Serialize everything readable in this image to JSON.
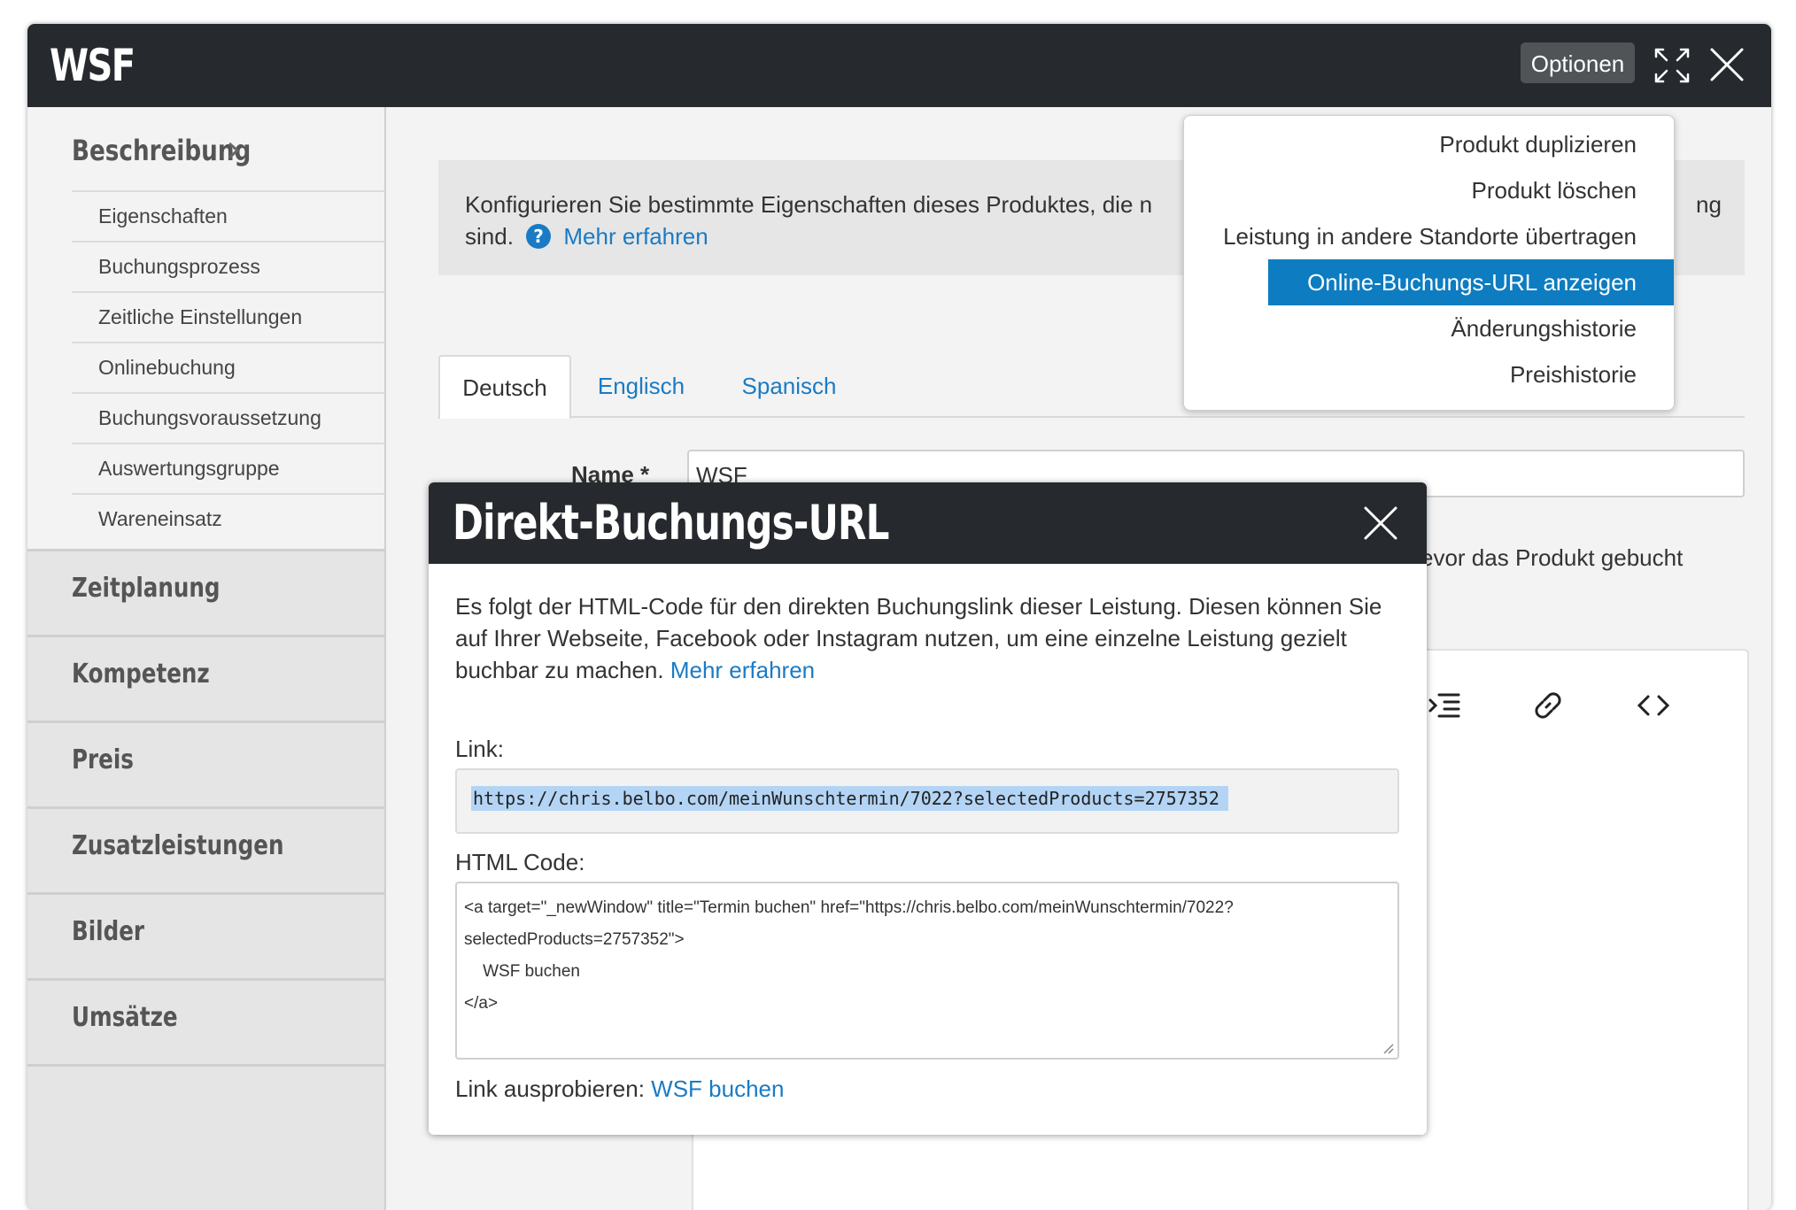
{
  "app": {
    "title": "WSF"
  },
  "topbar": {
    "options_label": "Optionen"
  },
  "sidebar": {
    "section_title": "Beschreibung",
    "sub_items": [
      "Eigenschaften",
      "Buchungsprozess",
      "Zeitliche Einstellungen",
      "Onlinebuchung",
      "Buchungsvoraussetzung",
      "Auswertungsgruppe",
      "Wareneinsatz"
    ],
    "groups": [
      "Zeitplanung",
      "Kompetenz",
      "Preis",
      "Zusatzleistungen",
      "Bilder",
      "Umsätze"
    ]
  },
  "info": {
    "text_line1": "Konfigurieren Sie bestimmte Eigenschaften dieses Produktes, die n",
    "text_line2": "sind.",
    "link": "Mehr erfahren",
    "tail": "ng"
  },
  "tabs": [
    {
      "label": "Deutsch",
      "active": true
    },
    {
      "label": "Englisch",
      "active": false
    },
    {
      "label": "Spanisch",
      "active": false
    }
  ],
  "form": {
    "name_label": "Name *",
    "name_value": "WSF",
    "partial_text": "evor das Produkt gebucht"
  },
  "dropdown": {
    "items": [
      "Produkt duplizieren",
      "Produkt löschen",
      "Leistung in andere Standorte übertragen",
      "Online-Buchungs-URL anzeigen",
      "Änderungshistorie",
      "Preishistorie"
    ],
    "active_index": 3
  },
  "modal": {
    "title": "Direkt-Buchungs-URL",
    "description": "Es folgt der HTML-Code für den direkten Buchungslink dieser Leistung. Diesen können Sie auf Ihrer Webseite, Facebook oder Instagram nutzen, um eine einzelne Leistung gezielt buchbar zu machen.",
    "description_link": "Mehr erfahren",
    "link_label": "Link:",
    "link_value": "https://chris.belbo.com/meinWunschtermin/7022?selectedProducts=2757352",
    "html_label": "HTML Code:",
    "html_code": "<a target=\"_newWindow\" title=\"Termin buchen\" href=\"https://chris.belbo.com/meinWunschtermin/7022?\nselectedProducts=2757352\">\n    WSF buchen\n</a>",
    "try_label": "Link ausprobieren:",
    "try_link": "WSF buchen"
  },
  "colors": {
    "accent": "#1a7bc4",
    "highlight": "#0d7cc1",
    "header": "#262a2e"
  }
}
